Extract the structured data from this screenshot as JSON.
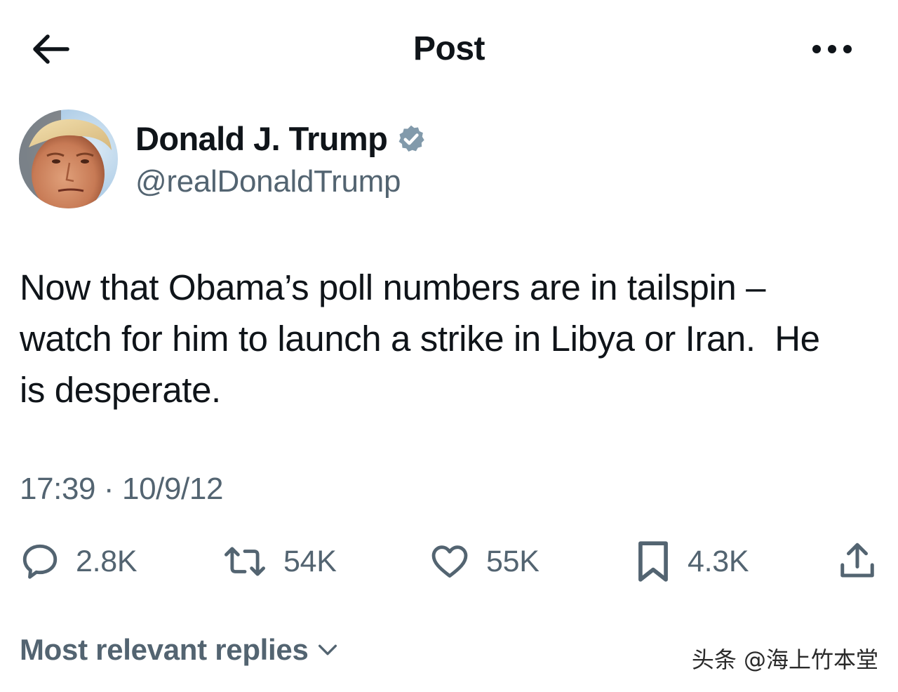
{
  "header": {
    "title": "Post",
    "back_icon": "arrow-left-icon",
    "more_icon": "more-horizontal-icon"
  },
  "author": {
    "display_name": "Donald J. Trump",
    "handle": "@realDonaldTrump",
    "verified_icon": "verified-badge-icon",
    "verified_color": "#829aab"
  },
  "post": {
    "text": "Now that Obama’s poll numbers are in tailspin –\nwatch for him to launch a strike in Libya or Iran.  He\nis desperate.",
    "timestamp": "17:39 · 10/9/12"
  },
  "actions": {
    "replies": {
      "icon": "reply-icon",
      "count": "2.8K"
    },
    "reposts": {
      "icon": "repost-icon",
      "count": "54K"
    },
    "likes": {
      "icon": "heart-icon",
      "count": "55K"
    },
    "bookmarks": {
      "icon": "bookmark-icon",
      "count": "4.3K"
    },
    "share": {
      "icon": "share-icon"
    }
  },
  "replies_sort": {
    "label": "Most relevant replies",
    "icon": "chevron-down-icon"
  },
  "watermark": {
    "text": "头条 @海上竹本堂"
  },
  "colors": {
    "text_primary": "#0f1419",
    "text_secondary": "#536471",
    "background": "#ffffff"
  }
}
